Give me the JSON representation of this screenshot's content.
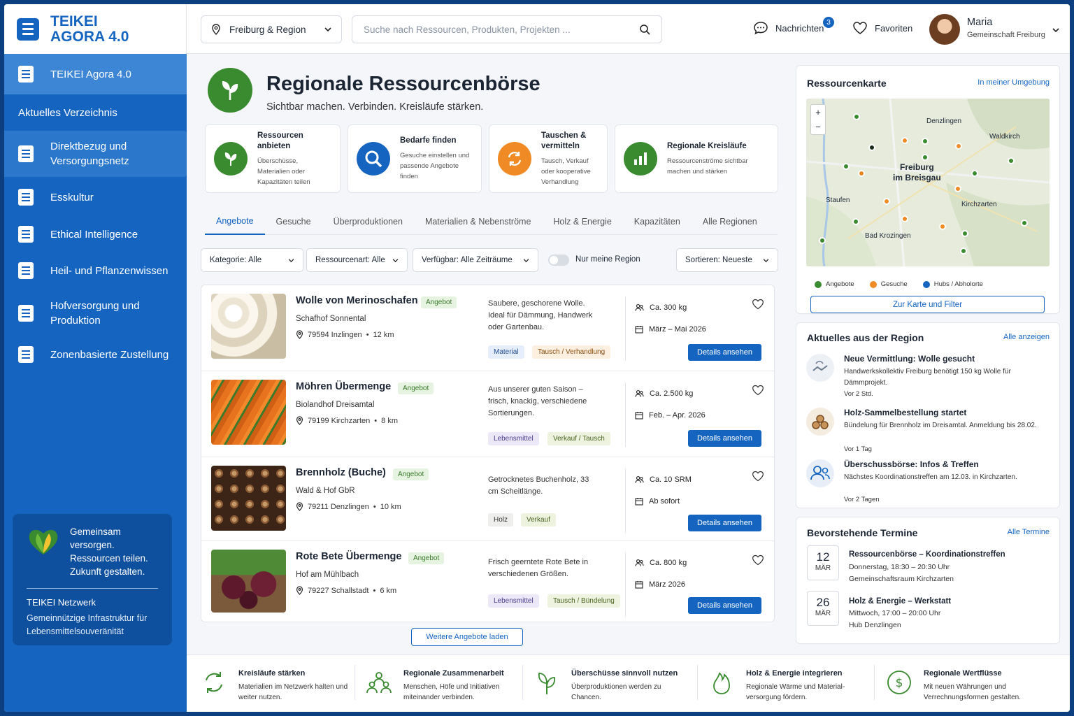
{
  "brand": {
    "line1": "TEIKEI",
    "line2": "AGORA 4.0"
  },
  "sidebar": {
    "top_item": "TEIKEI Agora 4.0",
    "section": "Aktuelles Verzeichnis",
    "items": [
      {
        "label": "Direktbezug und Versorgungsnetz",
        "active": true
      },
      {
        "label": "Esskultur"
      },
      {
        "label": "Ethical Intelligence"
      },
      {
        "label": "Heil- und Pflanzenwissen"
      },
      {
        "label": "Hofversorgung und Produktion"
      },
      {
        "label": "Zonenbasierte Zustellung"
      }
    ],
    "promo": {
      "slogan": "Gemeinsam versorgen. Ressourcen teilen. Zukunft gestalten.",
      "title": "TEIKEI Netzwerk",
      "subtitle": "Gemeinnützige Infrastruktur für Lebensmittelsouveränität"
    }
  },
  "header": {
    "region": "Freiburg & Region",
    "search_placeholder": "Suche nach Ressourcen, Produkten, Projekten ...",
    "messages_label": "Nachrichten",
    "messages_count": "3",
    "favorites_label": "Favoriten",
    "user_name": "Maria",
    "user_group": "Gemeinschaft Freiburg"
  },
  "hero": {
    "title": "Regionale Ressourcenbörse",
    "subtitle": "Sichtbar machen. Verbinden. Kreisläufe stärken."
  },
  "actions": [
    {
      "title": "Ressourcen anbieten",
      "text": "Überschüsse, Materialien oder Kapazitäten teilen"
    },
    {
      "title": "Bedarfe finden",
      "text": "Gesuche einstellen und passende Angebote finden"
    },
    {
      "title": "Tauschen & vermitteln",
      "text": "Tausch, Verkauf oder kooperative Verhandlung"
    },
    {
      "title": "Regionale Kreisläufe",
      "text": "Ressourcenströme sichtbar machen und stärken"
    }
  ],
  "tabs": [
    "Angebote",
    "Gesuche",
    "Überproduktionen",
    "Materialien & Nebenströme",
    "Holz & Energie",
    "Kapazitäten",
    "Alle Regionen"
  ],
  "filters": {
    "category": "Kategorie: Alle",
    "resource_type": "Ressourcenart: Alle",
    "availability": "Verfügbar: Alle Zeiträume",
    "only_region": "Nur meine Region",
    "sort": "Sortieren: Neueste"
  },
  "listings": [
    {
      "title": "Wolle von Merinoschafen",
      "tag": "Angebot",
      "farm": "Schafhof Sonnental",
      "location": "79594 Inzlingen",
      "distance": "12 km",
      "desc": "Saubere, geschorene Wolle. Ideal für Dämmung, Handwerk oder Gartenbau.",
      "pill1": "Material",
      "pill2": "Tausch / Verhandlung",
      "amount": "Ca. 300 kg",
      "period": "März – Mai 2026",
      "button": "Details ansehen"
    },
    {
      "title": "Möhren Übermenge",
      "tag": "Angebot",
      "farm": "Biolandhof Dreisamtal",
      "location": "79199 Kirchzarten",
      "distance": "8 km",
      "desc": "Aus unserer guten Saison – frisch, knackig, verschiedene Sortierungen.",
      "pill1": "Lebensmittel",
      "pill2": "Verkauf / Tausch",
      "amount": "Ca. 2.500 kg",
      "period": "Feb. – Apr. 2026",
      "button": "Details ansehen"
    },
    {
      "title": "Brennholz (Buche)",
      "tag": "Angebot",
      "farm": "Wald & Hof GbR",
      "location": "79211 Denzlingen",
      "distance": "10 km",
      "desc": "Getrocknetes Buchenholz, 33 cm Scheitlänge.",
      "pill1": "Holz",
      "pill2": "Verkauf",
      "amount": "Ca. 10 SRM",
      "period": "Ab sofort",
      "button": "Details ansehen"
    },
    {
      "title": "Rote Bete Übermenge",
      "tag": "Angebot",
      "farm": "Hof am Mühlbach",
      "location": "79227 Schallstadt",
      "distance": "6 km",
      "desc": "Frisch geerntete Rote Bete in verschiedenen Größen.",
      "pill1": "Lebensmittel",
      "pill2": "Tausch / Bündelung",
      "amount": "Ca. 800 kg",
      "period": "März 2026",
      "button": "Details ansehen"
    }
  ],
  "load_more": "Weitere Angebote laden",
  "map_card": {
    "title": "Ressourcenkarte",
    "link": "In meiner Umgebung",
    "places": [
      "Denzlingen",
      "Waldkirch",
      "Freiburg",
      "im Breisgau",
      "Staufen",
      "Kirchzarten",
      "Bad Krozingen"
    ],
    "legend": [
      "Angebote",
      "Gesuche",
      "Hubs / Abholorte"
    ],
    "button": "Zur Karte und Filter",
    "zoom_in": "+",
    "zoom_out": "−"
  },
  "news_card": {
    "title": "Aktuelles aus der Region",
    "link": "Alle anzeigen",
    "items": [
      {
        "title": "Neue Vermittlung: Wolle gesucht",
        "text": "Handwerkskollektiv Freiburg benötigt 150 kg Wolle für Dämmprojekt.",
        "time": "Vor 2 Std."
      },
      {
        "title": "Holz-Sammelbestellung startet",
        "text": "Bündelung für Brennholz im Dreisamtal. Anmeldung bis 28.02.",
        "time": "Vor 1 Tag"
      },
      {
        "title": "Überschussbörse: Infos & Treffen",
        "text": "Nächstes Koordinationstreffen am 12.03. in Kirchzarten.",
        "time": "Vor 2 Tagen"
      }
    ]
  },
  "events_card": {
    "title": "Bevorstehende Termine",
    "link": "Alle Termine",
    "items": [
      {
        "day": "12",
        "month": "MÄR",
        "title": "Ressourcenbörse – Koordinationstreffen",
        "when": "Donnerstag, 18:30 – 20:30 Uhr",
        "where": "Gemeinschaftsraum Kirchzarten"
      },
      {
        "day": "26",
        "month": "MÄR",
        "title": "Holz & Energie – Werkstatt",
        "when": "Mittwoch, 17:00 – 20:00 Uhr",
        "where": "Hub Denzlingen"
      }
    ]
  },
  "footer": [
    {
      "title": "Kreisläufe stärken",
      "text": "Materialien im Netzwerk halten und weiter nutzen."
    },
    {
      "title": "Regionale Zusammenarbeit",
      "text": "Menschen, Höfe und Initiativen miteinander verbinden."
    },
    {
      "title": "Überschüsse sinnvoll nutzen",
      "text": "Überproduktionen werden zu Chancen."
    },
    {
      "title": "Holz & Energie integrieren",
      "text": "Regionale Wärme und Material-versorgung fördern."
    },
    {
      "title": "Regionale Wertflüsse",
      "text": "Mit neuen Währungen und Verrechnungsformen gestalten."
    }
  ],
  "colors": {
    "primary": "#1565c0",
    "green": "#3a8a2f",
    "orange": "#f08a24",
    "offer_tag": "#e6f3e1"
  }
}
